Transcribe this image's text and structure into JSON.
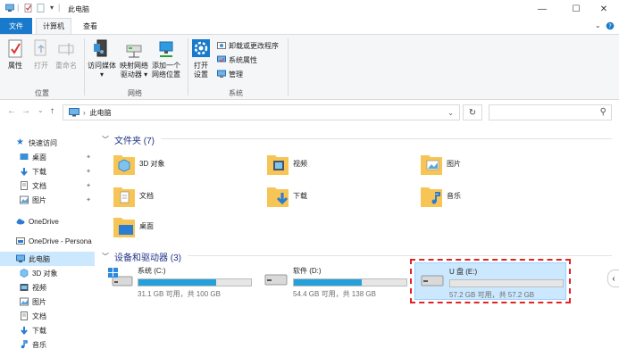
{
  "window": {
    "title": "此电脑",
    "minimize": "—",
    "maximize": "☐",
    "close": "✕"
  },
  "tabs": [
    "文件",
    "计算机",
    "查看"
  ],
  "ribbon": {
    "location": {
      "label": "位置",
      "buttons": [
        "属性",
        "打开",
        "重命名"
      ]
    },
    "network": {
      "label": "网络",
      "buttons": [
        {
          "line1": "访问媒体",
          "line2": "▾"
        },
        {
          "line1": "映射网络",
          "line2": "驱动器 ▾"
        },
        {
          "line1": "添加一个",
          "line2": "网络位置"
        }
      ]
    },
    "system": {
      "label": "系统",
      "open_settings": {
        "line1": "打开",
        "line2": "设置"
      },
      "small": [
        "卸载或更改程序",
        "系统属性",
        "管理"
      ]
    }
  },
  "address": {
    "back": "←",
    "forward": "→",
    "recent": "⌄",
    "up": "↑",
    "crumb_sep": "›",
    "location": "此电脑",
    "dropdown": "⌄",
    "refresh": "↻",
    "search_icon": "⚲"
  },
  "sidebar": {
    "quick_access": "快速访问",
    "pinned": [
      {
        "label": "桌面",
        "pin": "✦"
      },
      {
        "label": "下载",
        "pin": "✦"
      },
      {
        "label": "文档",
        "pin": "✦"
      },
      {
        "label": "图片",
        "pin": "✦"
      }
    ],
    "onedrive": "OneDrive",
    "onedrive_personal": "OneDrive - Persona",
    "this_pc": "此电脑",
    "this_pc_children": [
      "3D 对象",
      "视频",
      "图片",
      "文档",
      "下载",
      "音乐"
    ]
  },
  "main": {
    "folders_header": "文件夹 (7)",
    "folders": [
      "3D 对象",
      "视频",
      "图片",
      "文档",
      "下载",
      "音乐",
      "桌面"
    ],
    "devices_header": "设备和驱动器 (3)",
    "drives": [
      {
        "name": "系统 (C:)",
        "free": "31.1 GB 可用，共 100 GB",
        "used_fraction": 0.689
      },
      {
        "name": "软件 (D:)",
        "free": "54.4 GB 可用，共 138 GB",
        "used_fraction": 0.606
      },
      {
        "name": "U 盘 (E:)",
        "free": "57.2 GB 可用，共 57.2 GB",
        "used_fraction": 0.0
      }
    ],
    "chevron": "﹀",
    "scroll_arrow": "‹"
  },
  "colors": {
    "accent": "#1979ca",
    "selection": "#cce8ff",
    "drive_bar": "#26a0da",
    "highlight": "#e02424",
    "folder": "#f6c555"
  }
}
